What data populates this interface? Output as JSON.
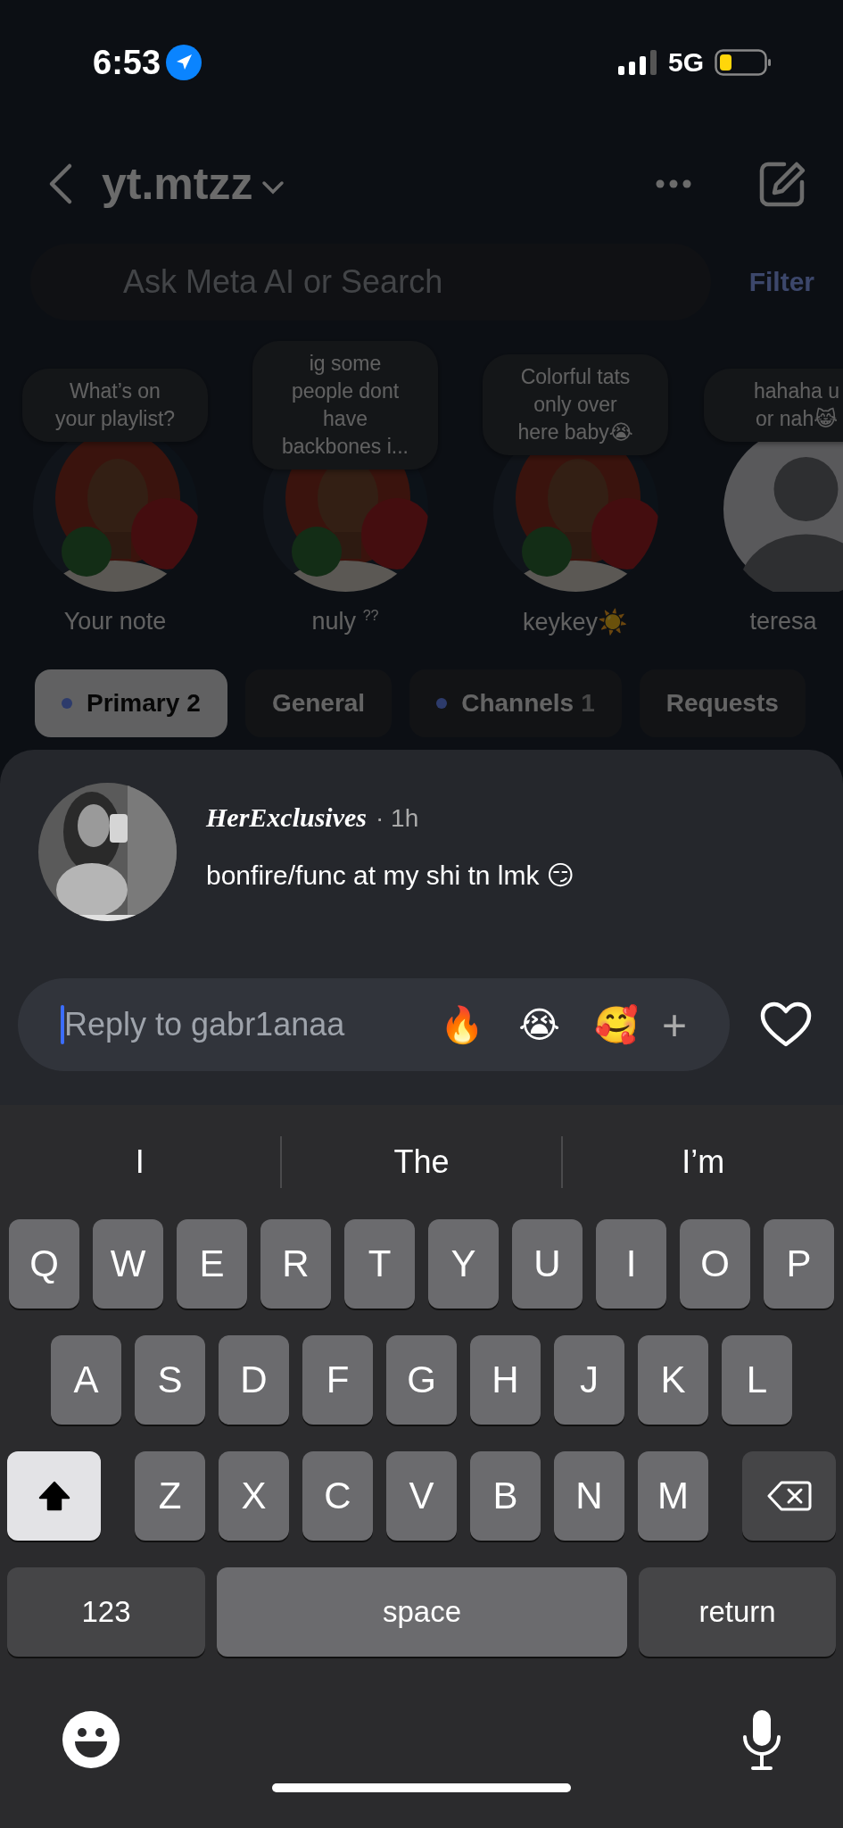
{
  "status_bar": {
    "time": "6:53",
    "network": "5G"
  },
  "header": {
    "title": "yt.mtzz"
  },
  "search": {
    "placeholder": "Ask Meta AI or Search",
    "filter": "Filter"
  },
  "notes": [
    {
      "note": "What’s on\nyour playlist?",
      "name": "Your note"
    },
    {
      "note": "ig some\npeople dont\nhave\nbackbones i...",
      "name": "nuly $^{??}$"
    },
    {
      "note": "Colorful tats\nonly over\nhere baby😭",
      "name": "keykey☀️"
    },
    {
      "note": "hahaha u\nor nah😹",
      "name": "teresa",
      "kind": "silhouette"
    }
  ],
  "tabs": [
    {
      "label": "Primary",
      "count": "2",
      "selected": true,
      "unread": true
    },
    {
      "label": "General",
      "selected": false,
      "unread": false
    },
    {
      "label": "Channels",
      "count": "1",
      "selected": false,
      "unread": true
    },
    {
      "label": "Requests",
      "selected": false,
      "unread": false
    }
  ],
  "message": {
    "sender": "HerExclusives",
    "time": "· 1h",
    "text": "bonfire/func at my shi tn lmk 😏"
  },
  "reply": {
    "placeholder": "Reply to gabr1anaa",
    "reactions": [
      "🔥",
      "😭",
      "🥰"
    ],
    "add": "+"
  },
  "keyboard": {
    "suggestions": [
      "I",
      "The",
      "I’m"
    ],
    "rows": [
      [
        "Q",
        "W",
        "E",
        "R",
        "T",
        "Y",
        "U",
        "I",
        "O",
        "P"
      ],
      [
        "A",
        "S",
        "D",
        "F",
        "G",
        "H",
        "J",
        "K",
        "L"
      ],
      [
        "Z",
        "X",
        "C",
        "V",
        "B",
        "N",
        "M"
      ]
    ],
    "shift_on": true,
    "numbers": "123",
    "space": "space",
    "return": "return"
  }
}
